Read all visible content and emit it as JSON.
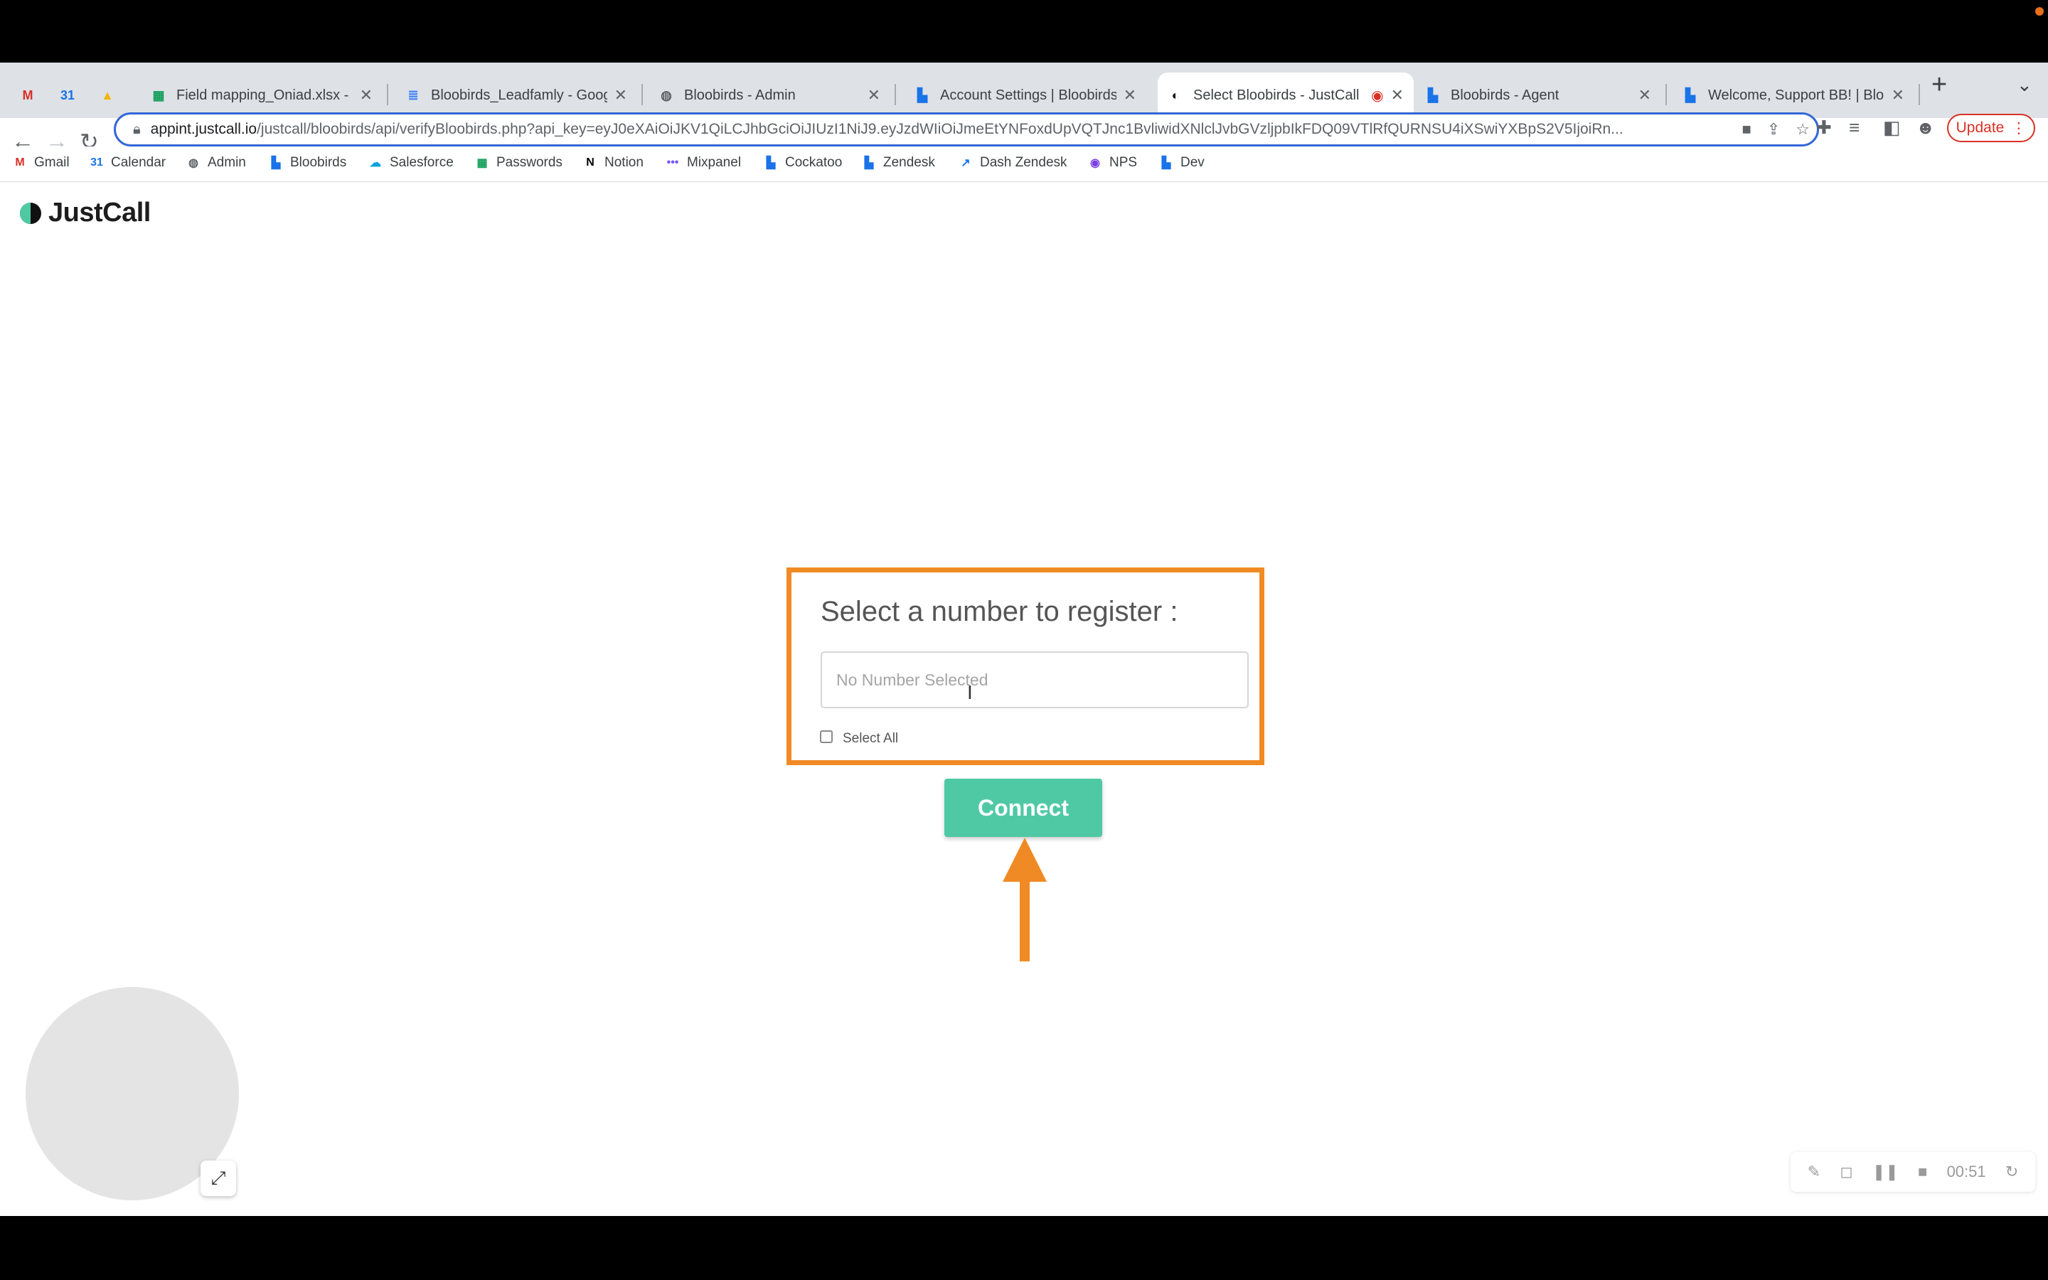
{
  "tabs": [
    {
      "icon": "gmail-icon",
      "glyph": "M",
      "color": "#d93025",
      "title": ""
    },
    {
      "icon": "calendar-icon",
      "glyph": "31",
      "color": "#1a73e8",
      "title": ""
    },
    {
      "icon": "drive-icon",
      "glyph": "▲",
      "color": "#f4b400",
      "title": ""
    },
    {
      "icon": "sheets-icon",
      "glyph": "▦",
      "color": "#0f9d58",
      "title": "Field mapping_Oniad.xlsx - Go"
    },
    {
      "icon": "docs-icon",
      "glyph": "≣",
      "color": "#4285f4",
      "title": "Bloobirds_Leadfamly - Google"
    },
    {
      "icon": "globe-icon",
      "glyph": "◍",
      "color": "#5f6368",
      "title": "Bloobirds - Admin"
    },
    {
      "icon": "bloobirds-icon",
      "glyph": "▙",
      "color": "#1a73e8",
      "title": "Account Settings | Bloobirds"
    },
    {
      "icon": "justcall-icon",
      "glyph": "◐",
      "color": "#111111",
      "title": "Select Bloobirds - JustCall"
    },
    {
      "icon": "bloobirds-icon",
      "glyph": "▙",
      "color": "#1a73e8",
      "title": "Bloobirds - Agent"
    },
    {
      "icon": "bloobirds-icon",
      "glyph": "▙",
      "color": "#1a73e8",
      "title": "Welcome, Support BB! | Bloob"
    }
  ],
  "address_bar": {
    "host": "appint.justcall.io",
    "path": "/justcall/bloobirds/api/verifyBloobirds.php?api_key=eyJ0eXAiOiJKV1QiLCJhbGciOiJIUzI1NiJ9.eyJzdWIiOiJmeEtYNFoxdUpVQTJnc1BvliwidXNlclJvbGVzljpbIkFDQ09VTlRfQURNSU4iXSwiYXBpS2V5IjoiRn..."
  },
  "toolbar": {
    "update_label": "Update"
  },
  "bookmarks": [
    {
      "icon": "gmail-icon",
      "glyph": "M",
      "color": "#d93025",
      "label": "Gmail"
    },
    {
      "icon": "calendar-icon",
      "glyph": "31",
      "color": "#1a73e8",
      "label": "Calendar"
    },
    {
      "icon": "globe-icon",
      "glyph": "◍",
      "color": "#5f6368",
      "label": "Admin"
    },
    {
      "icon": "bloobirds-icon",
      "glyph": "▙",
      "color": "#1a73e8",
      "label": "Bloobirds"
    },
    {
      "icon": "salesforce-icon",
      "glyph": "☁",
      "color": "#00a1e0",
      "label": "Salesforce"
    },
    {
      "icon": "sheets-icon",
      "glyph": "▦",
      "color": "#0f9d58",
      "label": "Passwords"
    },
    {
      "icon": "notion-icon",
      "glyph": "N",
      "color": "#000000",
      "label": "Notion"
    },
    {
      "icon": "mixpanel-icon",
      "glyph": "•••",
      "color": "#7856ff",
      "label": "Mixpanel"
    },
    {
      "icon": "bloobirds-icon",
      "glyph": "▙",
      "color": "#1a73e8",
      "label": "Cockatoo"
    },
    {
      "icon": "bloobirds-icon",
      "glyph": "▙",
      "color": "#1a73e8",
      "label": "Zendesk"
    },
    {
      "icon": "chart-icon",
      "glyph": "↗",
      "color": "#1a73e8",
      "label": "Dash Zendesk"
    },
    {
      "icon": "nps-icon",
      "glyph": "◉",
      "color": "#7b3fe4",
      "label": "NPS"
    },
    {
      "icon": "bloobirds-icon",
      "glyph": "▙",
      "color": "#1a73e8",
      "label": "Dev"
    }
  ],
  "page": {
    "logo_text": "JustCall",
    "prompt": "Select a number to register :",
    "number_placeholder": "No Number Selected",
    "select_all_label": "Select All",
    "connect_label": "Connect"
  },
  "recorder": {
    "timer": "00:51"
  },
  "colors": {
    "accent": "#4fc9a4",
    "annotation": "#f08a24"
  }
}
